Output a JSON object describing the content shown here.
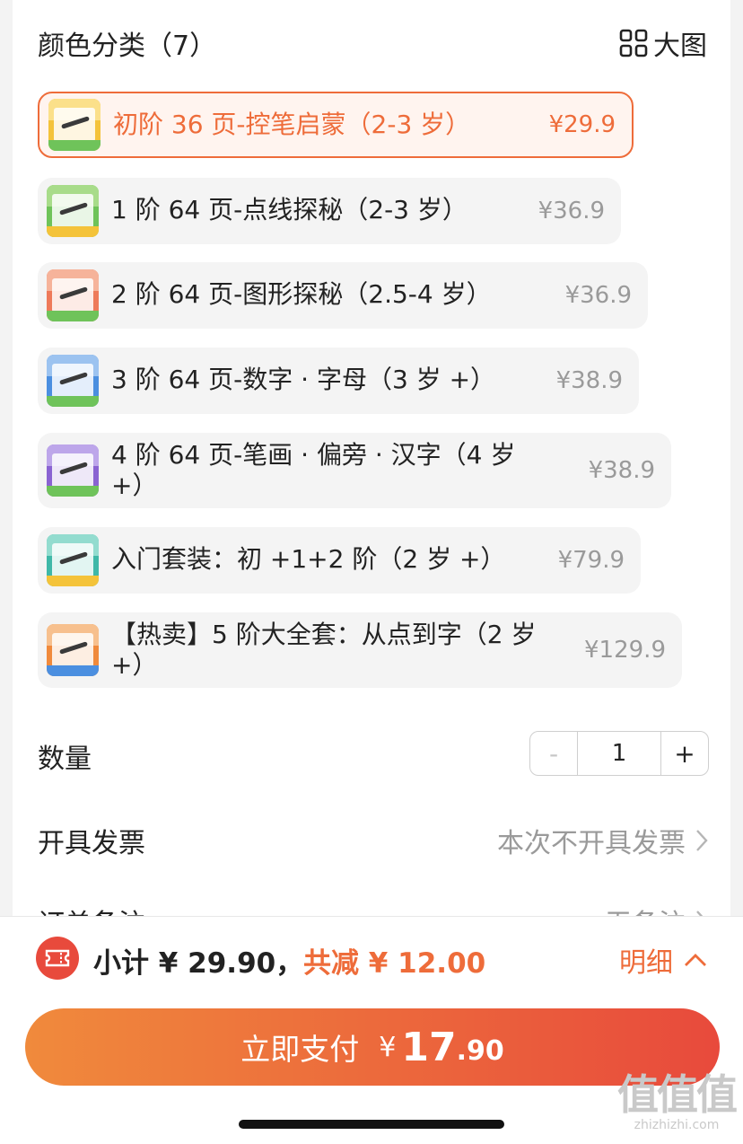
{
  "section": {
    "title": "颜色分类（7）",
    "big_view_label": "大图"
  },
  "options": [
    {
      "label": "初阶 36 页-控笔启蒙（2-3 岁）",
      "price": "¥29.9",
      "selected": true,
      "thumb_color": "#f4c33a"
    },
    {
      "label": "1 阶 64 页-点线探秘（2-3 岁）",
      "price": "¥36.9",
      "selected": false,
      "thumb_color": "#6fc35a"
    },
    {
      "label": "2 阶 64 页-图形探秘（2.5-4 岁）",
      "price": "¥36.9",
      "selected": false,
      "thumb_color": "#ee7a5a"
    },
    {
      "label": "3 阶 64 页-数字 · 字母（3 岁 +）",
      "price": "¥38.9",
      "selected": false,
      "thumb_color": "#4b8fe0"
    },
    {
      "label": "4 阶 64 页-笔画 · 偏旁 · 汉字（4 岁 +）",
      "price": "¥38.9",
      "selected": false,
      "thumb_color": "#8a63d2"
    },
    {
      "label": "入门套装：初 +1+2 阶（2 岁 +）",
      "price": "¥79.9",
      "selected": false,
      "thumb_color": "#3fb8a8"
    },
    {
      "label": "【热卖】5 阶大全套：从点到字（2 岁 +）",
      "price": "¥129.9",
      "selected": false,
      "thumb_color": "#f08a3c"
    }
  ],
  "quantity": {
    "label": "数量",
    "value": "1",
    "minus": "-",
    "plus": "+"
  },
  "invoice": {
    "label": "开具发票",
    "value": "本次不开具发票"
  },
  "remark": {
    "label": "订单备注",
    "value": "无备注"
  },
  "summary": {
    "subtotal": "小计 ¥ 29.90，",
    "discount": "共减 ¥ 12.00",
    "detail": "明细"
  },
  "pay": {
    "label": "立即支付",
    "currency": "¥",
    "amount_int": "17",
    "amount_dec": ".90"
  },
  "watermark": {
    "glyphs": "值值值",
    "url": "zhizhizhi.com"
  },
  "colors": {
    "accent": "#ee6c3a",
    "pay_gradient_start": "#f08a3c",
    "pay_gradient_end": "#e84a3c"
  }
}
